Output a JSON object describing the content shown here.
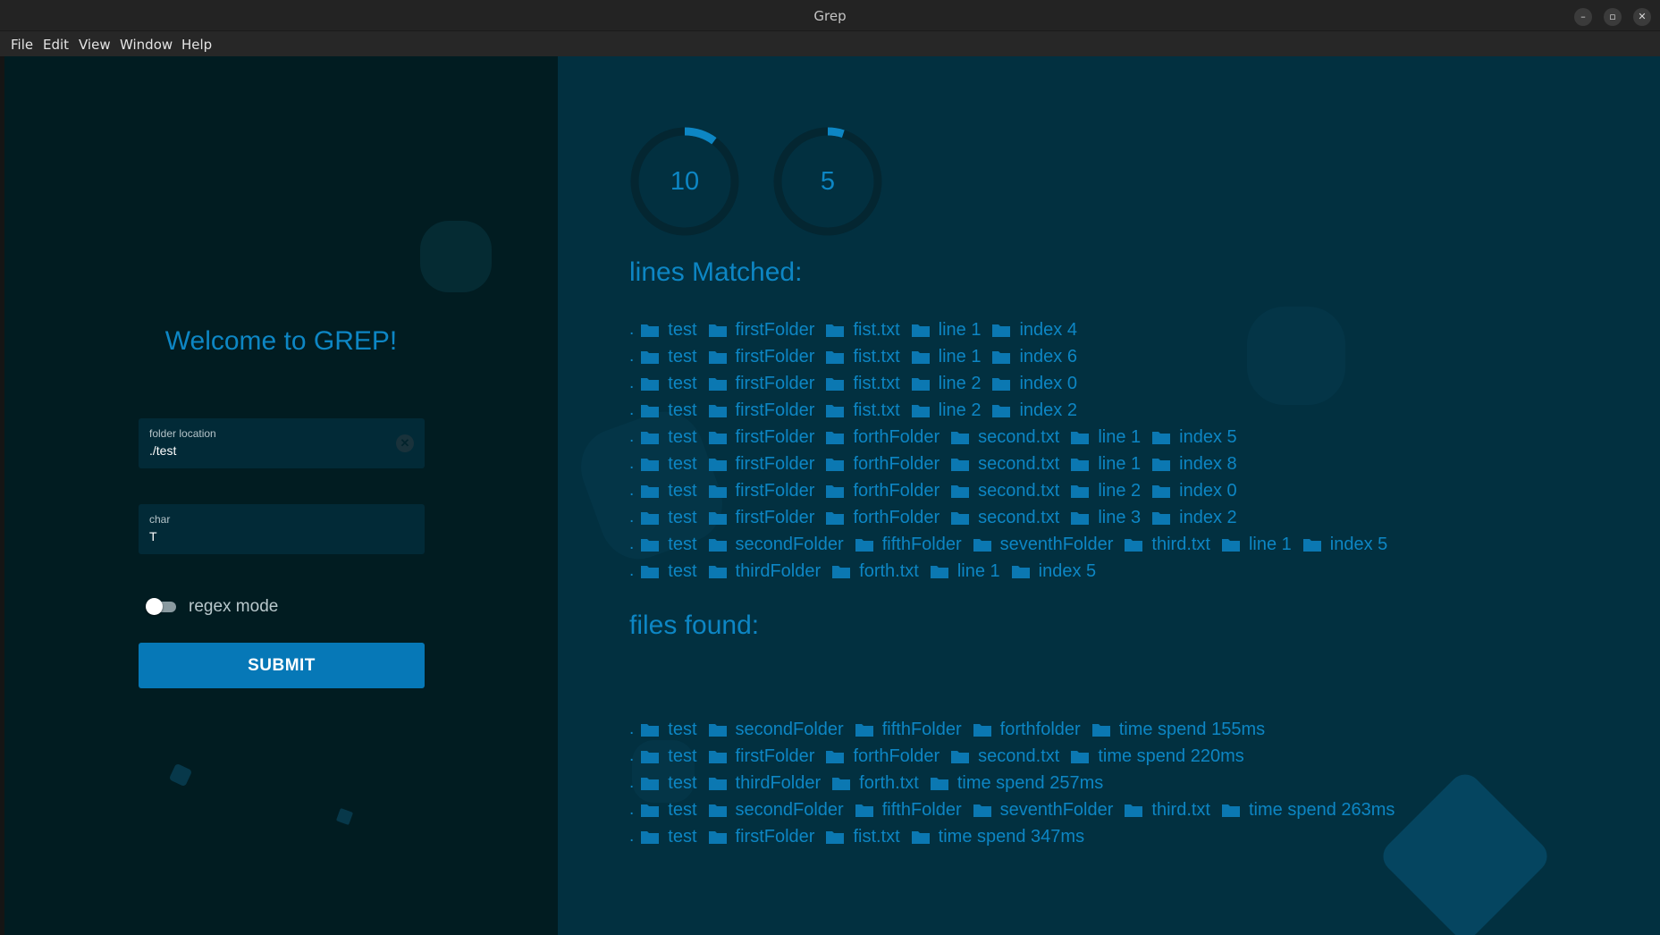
{
  "window": {
    "title": "Grep"
  },
  "window_controls": {
    "minimize": "–",
    "maximize": "▫",
    "close": "✕"
  },
  "menu": [
    "File",
    "Edit",
    "View",
    "Window",
    "Help"
  ],
  "left": {
    "welcome": "Welcome to GREP!",
    "folder_field": {
      "label": "folder location",
      "value": "./test"
    },
    "char_field": {
      "label": "char",
      "value": "T"
    },
    "regex_toggle": {
      "label": "regex mode",
      "on": false
    },
    "submit_label": "SUBMIT"
  },
  "stats": [
    {
      "value": "10",
      "progress": 0.1
    },
    {
      "value": "5",
      "progress": 0.05
    }
  ],
  "lines_heading": "lines Matched:",
  "lines": [
    [
      ".",
      "test",
      "firstFolder",
      "fist.txt",
      "line 1",
      "index 4"
    ],
    [
      ".",
      "test",
      "firstFolder",
      "fist.txt",
      "line 1",
      "index 6"
    ],
    [
      ".",
      "test",
      "firstFolder",
      "fist.txt",
      "line 2",
      "index 0"
    ],
    [
      ".",
      "test",
      "firstFolder",
      "fist.txt",
      "line 2",
      "index 2"
    ],
    [
      ".",
      "test",
      "firstFolder",
      "forthFolder",
      "second.txt",
      "line 1",
      "index 5"
    ],
    [
      ".",
      "test",
      "firstFolder",
      "forthFolder",
      "second.txt",
      "line 1",
      "index 8"
    ],
    [
      ".",
      "test",
      "firstFolder",
      "forthFolder",
      "second.txt",
      "line 2",
      "index 0"
    ],
    [
      ".",
      "test",
      "firstFolder",
      "forthFolder",
      "second.txt",
      "line 3",
      "index 2"
    ],
    [
      ".",
      "test",
      "secondFolder",
      "fifthFolder",
      "seventhFolder",
      "third.txt",
      "line 1",
      "index 5"
    ],
    [
      ".",
      "test",
      "thirdFolder",
      "forth.txt",
      "line 1",
      "index 5"
    ]
  ],
  "files_heading": "files found:",
  "files": [
    [
      ".",
      "test",
      "secondFolder",
      "fifthFolder",
      "forthfolder",
      "time spend 155ms"
    ],
    [
      ".",
      "test",
      "firstFolder",
      "forthFolder",
      "second.txt",
      "time spend 220ms"
    ],
    [
      ".",
      "test",
      "thirdFolder",
      "forth.txt",
      "time spend 257ms"
    ],
    [
      ".",
      "test",
      "secondFolder",
      "fifthFolder",
      "seventhFolder",
      "third.txt",
      "time spend 263ms"
    ],
    [
      ".",
      "test",
      "firstFolder",
      "fist.txt",
      "time spend 347ms"
    ]
  ],
  "icons": {
    "path_separator": "folder-icon"
  },
  "colors": {
    "accent": "#0d86c4",
    "submit": "#0678b7",
    "left_bg": "#011c21",
    "right_bg": "#023040"
  }
}
